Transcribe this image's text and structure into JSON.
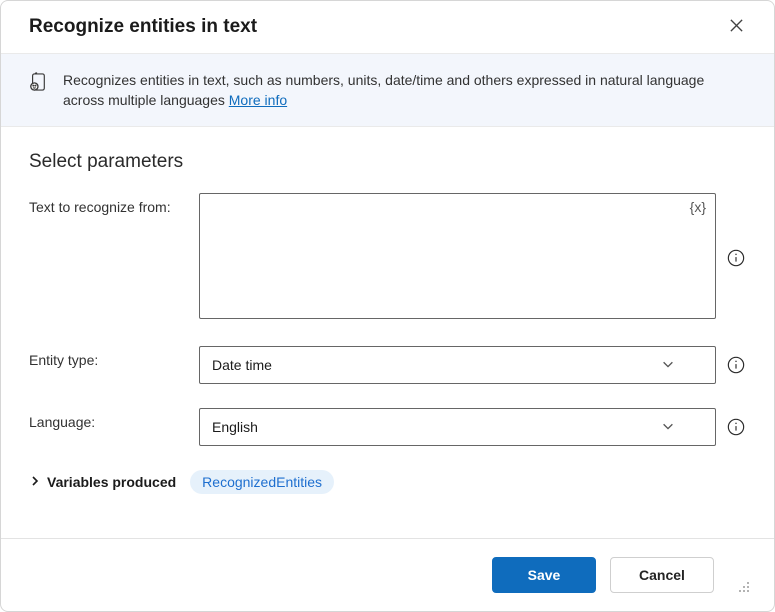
{
  "dialog": {
    "title": "Recognize entities in text",
    "banner": {
      "description": "Recognizes entities in text, such as numbers, units, date/time and others expressed in natural language across multiple languages ",
      "more_info_label": "More info"
    }
  },
  "section_heading": "Select parameters",
  "fields": {
    "text": {
      "label": "Text to recognize from:",
      "value": "",
      "placeholder": "",
      "var_icon_label": "{x}"
    },
    "entity_type": {
      "label": "Entity type:",
      "value": "Date time"
    },
    "language": {
      "label": "Language:",
      "value": "English"
    }
  },
  "variables_section": {
    "label": "Variables produced",
    "chip": "RecognizedEntities"
  },
  "footer": {
    "save_label": "Save",
    "cancel_label": "Cancel"
  }
}
